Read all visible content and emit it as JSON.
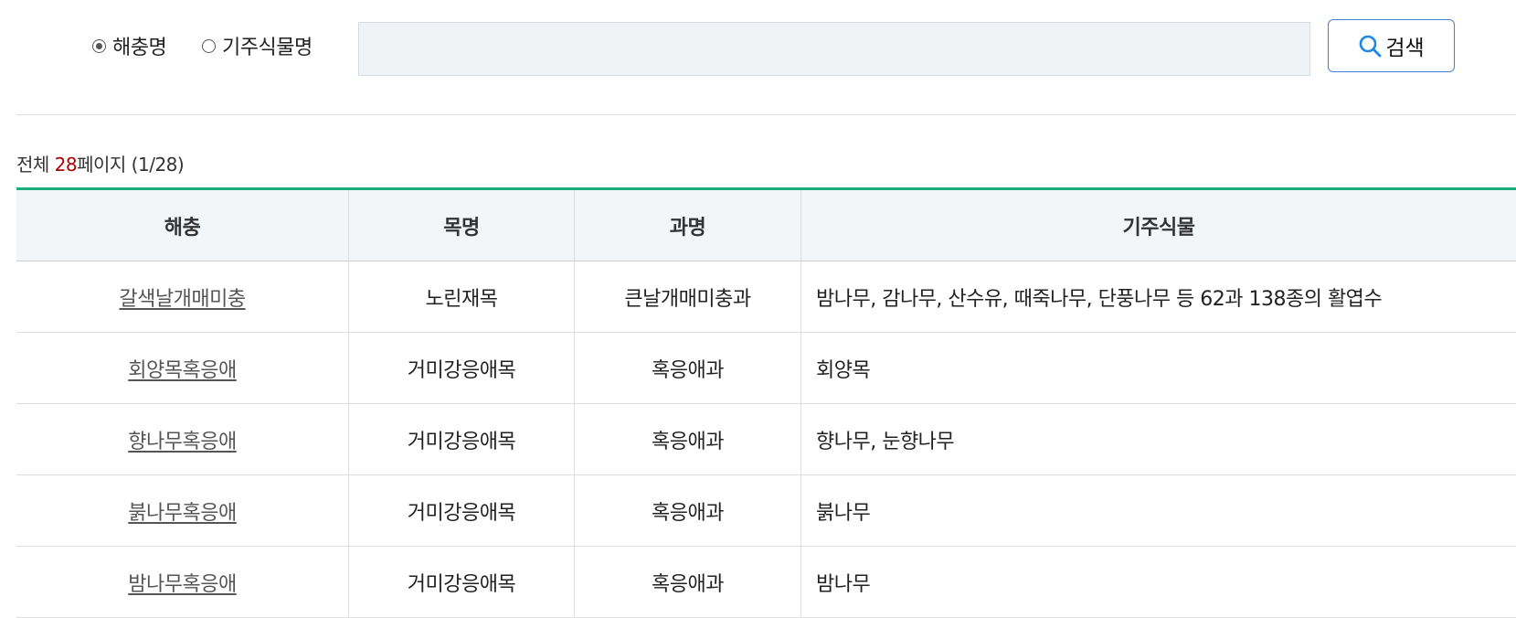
{
  "search": {
    "options": [
      "해충명",
      "기주식물명"
    ],
    "selected": "해충명",
    "input_value": "",
    "button_label": "검색"
  },
  "summary": {
    "prefix": "전체 ",
    "total": "28",
    "suffix": "페이지 (1/28)"
  },
  "table": {
    "headers": [
      "해충",
      "목명",
      "과명",
      "기주식물"
    ],
    "rows": [
      {
        "pest": "갈색날개매미충",
        "order": "노린재목",
        "family": "큰날개매미충과",
        "hosts": "밤나무, 감나무, 산수유, 때죽나무, 단풍나무 등 62과 138종의 활엽수"
      },
      {
        "pest": "회양목혹응애",
        "order": "거미강응애목",
        "family": "혹응애과",
        "hosts": "회양목"
      },
      {
        "pest": "향나무혹응애",
        "order": "거미강응애목",
        "family": "혹응애과",
        "hosts": "향나무, 눈향나무"
      },
      {
        "pest": "붉나무혹응애",
        "order": "거미강응애목",
        "family": "혹응애과",
        "hosts": "붉나무"
      },
      {
        "pest": "밤나무혹응애",
        "order": "거미강응애목",
        "family": "혹응애과",
        "hosts": "밤나무"
      }
    ]
  },
  "colors": {
    "accent_green": "#1aae7a",
    "count_red": "#b00000",
    "button_border": "#4a7fd6"
  }
}
